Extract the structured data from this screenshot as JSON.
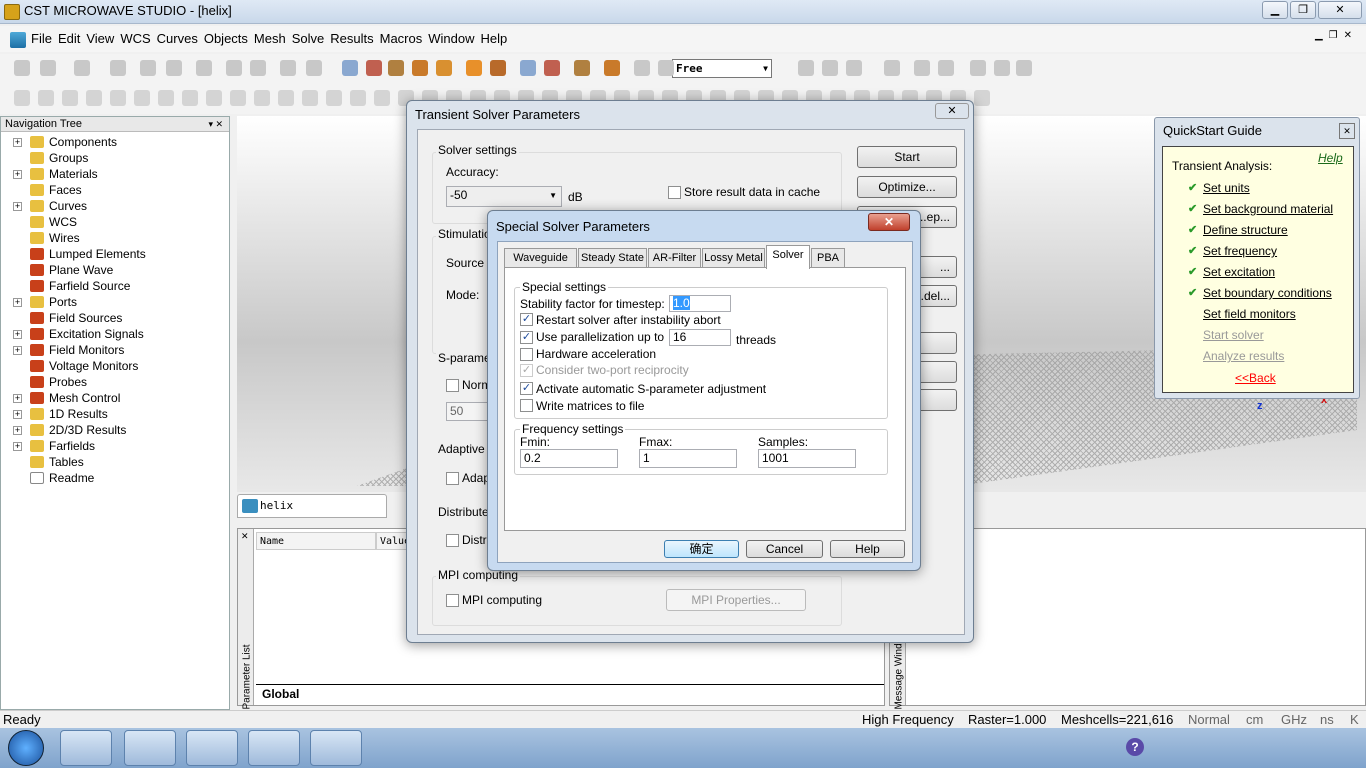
{
  "window": {
    "title": "CST MICROWAVE STUDIO - [helix]",
    "min": "▁",
    "max": "❐",
    "close": "✕"
  },
  "menu": [
    "File",
    "Edit",
    "View",
    "WCS",
    "Curves",
    "Objects",
    "Mesh",
    "Solve",
    "Results",
    "Macros",
    "Window",
    "Help"
  ],
  "toolbar": {
    "mode_select": "Free"
  },
  "nav": {
    "title": "Navigation Tree",
    "items": [
      {
        "label": "Components",
        "exp": true,
        "icon": "folder"
      },
      {
        "label": "Groups",
        "exp": false,
        "icon": "folder"
      },
      {
        "label": "Materials",
        "exp": true,
        "icon": "folder"
      },
      {
        "label": "Faces",
        "exp": false,
        "icon": "folder"
      },
      {
        "label": "Curves",
        "exp": true,
        "icon": "folder"
      },
      {
        "label": "WCS",
        "exp": false,
        "icon": "folder"
      },
      {
        "label": "Wires",
        "exp": false,
        "icon": "folder"
      },
      {
        "label": "Lumped Elements",
        "exp": false,
        "icon": "gear"
      },
      {
        "label": "Plane Wave",
        "exp": false,
        "icon": "gear"
      },
      {
        "label": "Farfield Source",
        "exp": false,
        "icon": "gear"
      },
      {
        "label": "Ports",
        "exp": true,
        "icon": "folder"
      },
      {
        "label": "Field Sources",
        "exp": false,
        "icon": "gear"
      },
      {
        "label": "Excitation Signals",
        "exp": true,
        "icon": "gear"
      },
      {
        "label": "Field Monitors",
        "exp": true,
        "icon": "gear"
      },
      {
        "label": "Voltage Monitors",
        "exp": false,
        "icon": "gear"
      },
      {
        "label": "Probes",
        "exp": false,
        "icon": "gear"
      },
      {
        "label": "Mesh Control",
        "exp": true,
        "icon": "gear"
      },
      {
        "label": "1D Results",
        "exp": true,
        "icon": "folder"
      },
      {
        "label": "2D/3D Results",
        "exp": true,
        "icon": "folder"
      },
      {
        "label": "Farfields",
        "exp": true,
        "icon": "folder"
      },
      {
        "label": "Tables",
        "exp": false,
        "icon": "folder"
      },
      {
        "label": "Readme",
        "exp": false,
        "icon": "doc"
      }
    ]
  },
  "doc_tab": "helix",
  "params": {
    "side_label": "Parameter List",
    "col_name": "Name",
    "col_value": "Value",
    "tab": "Global"
  },
  "msg": {
    "side_label": "Message Window"
  },
  "status": {
    "ready": "Ready",
    "module": "High Frequency",
    "raster": "Raster=1.000",
    "meshcells": "Meshcells=221,616",
    "mode": "Normal",
    "unit_len": "cm",
    "unit_freq": "GHz",
    "unit_time": "ns",
    "unit_temp": "K"
  },
  "transient": {
    "title": "Transient Solver Parameters",
    "solver_settings": "Solver settings",
    "accuracy_label": "Accuracy:",
    "accuracy": "-50",
    "db": "dB",
    "store_cache": "Store result data in cache",
    "stimulation": "Stimulation",
    "source": "Source t",
    "mode": "Mode:",
    "sparam": "S-paramet",
    "norm": "Norm",
    "norm_value": "50",
    "adaptive": "Adaptive",
    "adap": "Adap",
    "distributed": "Distribute",
    "distr": "Distri",
    "mpi_group": "MPI computing",
    "mpi_cb": "MPI computing",
    "mpi_props": "MPI Properties...",
    "start": "Start",
    "optimize": "Optimize...",
    "btn3": "...ep...",
    "btn4": "...",
    "btn5": "...del...",
    "close": "✕"
  },
  "special": {
    "title": "Special Solver Parameters",
    "tabs": [
      "Waveguide",
      "Steady State",
      "AR-Filter",
      "Lossy Metal",
      "Solver",
      "PBA"
    ],
    "active_tab": "Solver",
    "special_settings": "Special settings",
    "stability_label": "Stability factor for timestep:",
    "stability": "1.0",
    "restart": "Restart solver after instability abort",
    "parallel": "Use parallelization up to",
    "threads_value": "16",
    "threads": "threads",
    "hw": "Hardware acceleration",
    "reciprocity": "Consider two-port reciprocity",
    "auto_s": "Activate automatic S-parameter adjustment",
    "write": "Write matrices to file",
    "freq_settings": "Frequency settings",
    "fmin_label": "Fmin:",
    "fmin": "0.2",
    "fmax_label": "Fmax:",
    "fmax": "1",
    "samples_label": "Samples:",
    "samples": "1001",
    "ok": "确定",
    "cancel": "Cancel",
    "help": "Help",
    "close": "✕"
  },
  "quickstart": {
    "title": "QuickStart Guide",
    "help": "Help",
    "heading": "Transient Analysis:",
    "steps": [
      {
        "label": "Set units",
        "done": true
      },
      {
        "label": "Set background material",
        "done": true
      },
      {
        "label": "Define structure",
        "done": true
      },
      {
        "label": "Set frequency",
        "done": true
      },
      {
        "label": "Set excitation",
        "done": true
      },
      {
        "label": "Set boundary conditions",
        "done": true
      },
      {
        "label": "Set field monitors",
        "done": false
      },
      {
        "label": "Start solver",
        "done": false,
        "disabled": true
      },
      {
        "label": "Analyze results",
        "done": false,
        "disabled": true
      }
    ],
    "back": "<<Back",
    "close": "✕"
  }
}
